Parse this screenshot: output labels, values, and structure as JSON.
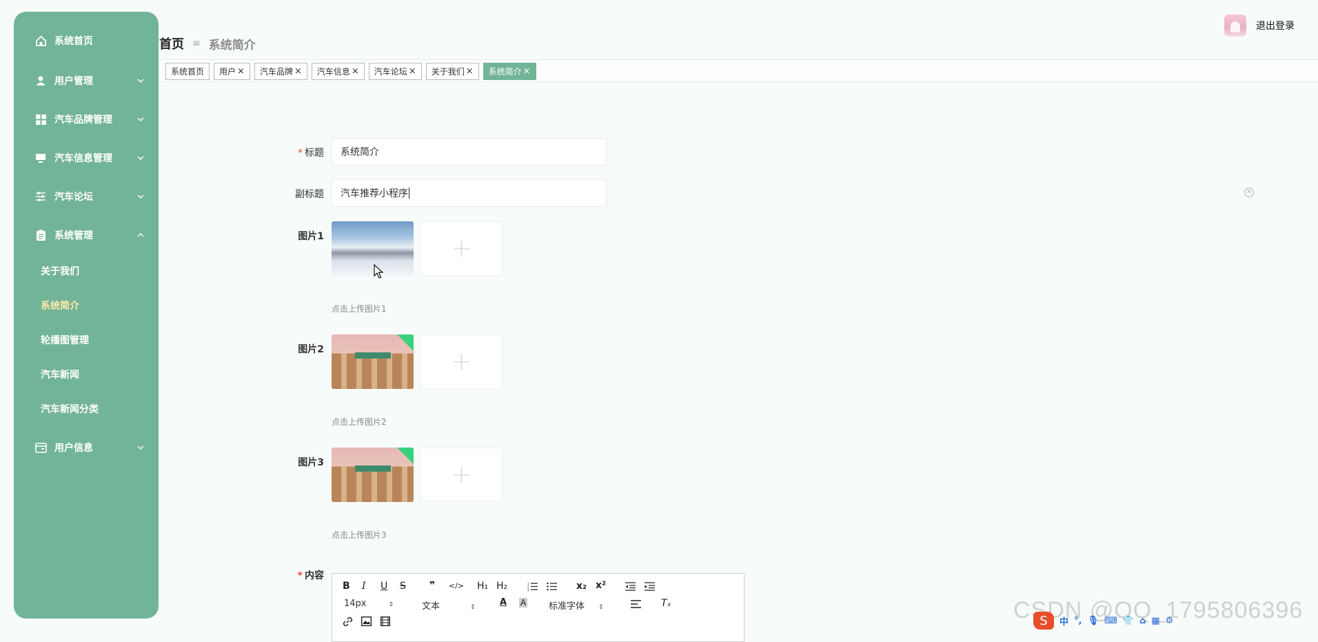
{
  "sidebar": {
    "items": [
      {
        "label": "系统首页",
        "icon": "home-icon"
      },
      {
        "label": "用户管理",
        "icon": "user-icon"
      },
      {
        "label": "汽车品牌管理",
        "icon": "grid-icon"
      },
      {
        "label": "汽车信息管理",
        "icon": "monitor-icon"
      },
      {
        "label": "汽车论坛",
        "icon": "sliders-icon"
      },
      {
        "label": "系统管理",
        "icon": "clipboard-icon"
      },
      {
        "label": "用户信息",
        "icon": "card-icon"
      }
    ],
    "sub_items": [
      "关于我们",
      "系统简介",
      "轮播图管理",
      "汽车新闻",
      "汽车新闻分类"
    ],
    "active_sub": "系统简介",
    "bg_color": "#72b497"
  },
  "header": {
    "breadcrumb_home": "首页",
    "breadcrumb_sep": "≡",
    "breadcrumb_current": "系统简介",
    "logout": "退出登录"
  },
  "tags": [
    {
      "label": "系统首页",
      "close": ""
    },
    {
      "label": "用户",
      "close": "×"
    },
    {
      "label": "汽车品牌",
      "close": "×"
    },
    {
      "label": "汽车信息",
      "close": "×"
    },
    {
      "label": "汽车论坛",
      "close": "×"
    },
    {
      "label": "关于我们",
      "close": "×"
    },
    {
      "label": "系统简介",
      "close": "×"
    }
  ],
  "form": {
    "title_label": "标题",
    "title_value": "系统简介",
    "subtitle_label": "副标题",
    "subtitle_value": "汽车推荐小程序",
    "pic1_label": "图片1",
    "pic1_hint": "点击上传图片1",
    "pic2_label": "图片2",
    "pic2_hint": "点击上传图片2",
    "pic3_label": "图片3",
    "pic3_hint": "点击上传图片3",
    "content_label": "内容",
    "required_mark": "*",
    "upload_plus": "+"
  },
  "editor": {
    "font_size": "14px",
    "text_type": "文本",
    "font_family": "标准字体",
    "bold": "B",
    "italic": "I",
    "underline": "U",
    "strike": "S",
    "quote": "❞",
    "code": "</>",
    "h1": "H₁",
    "h2": "H₂",
    "sub": "x₂",
    "sup": "x²",
    "clear": "Tₓ",
    "font_color": "A",
    "bg_color": "A"
  },
  "watermark": "CSDN @QQ_1795806396",
  "ime": {
    "lang": "中",
    "punct": "°,"
  }
}
